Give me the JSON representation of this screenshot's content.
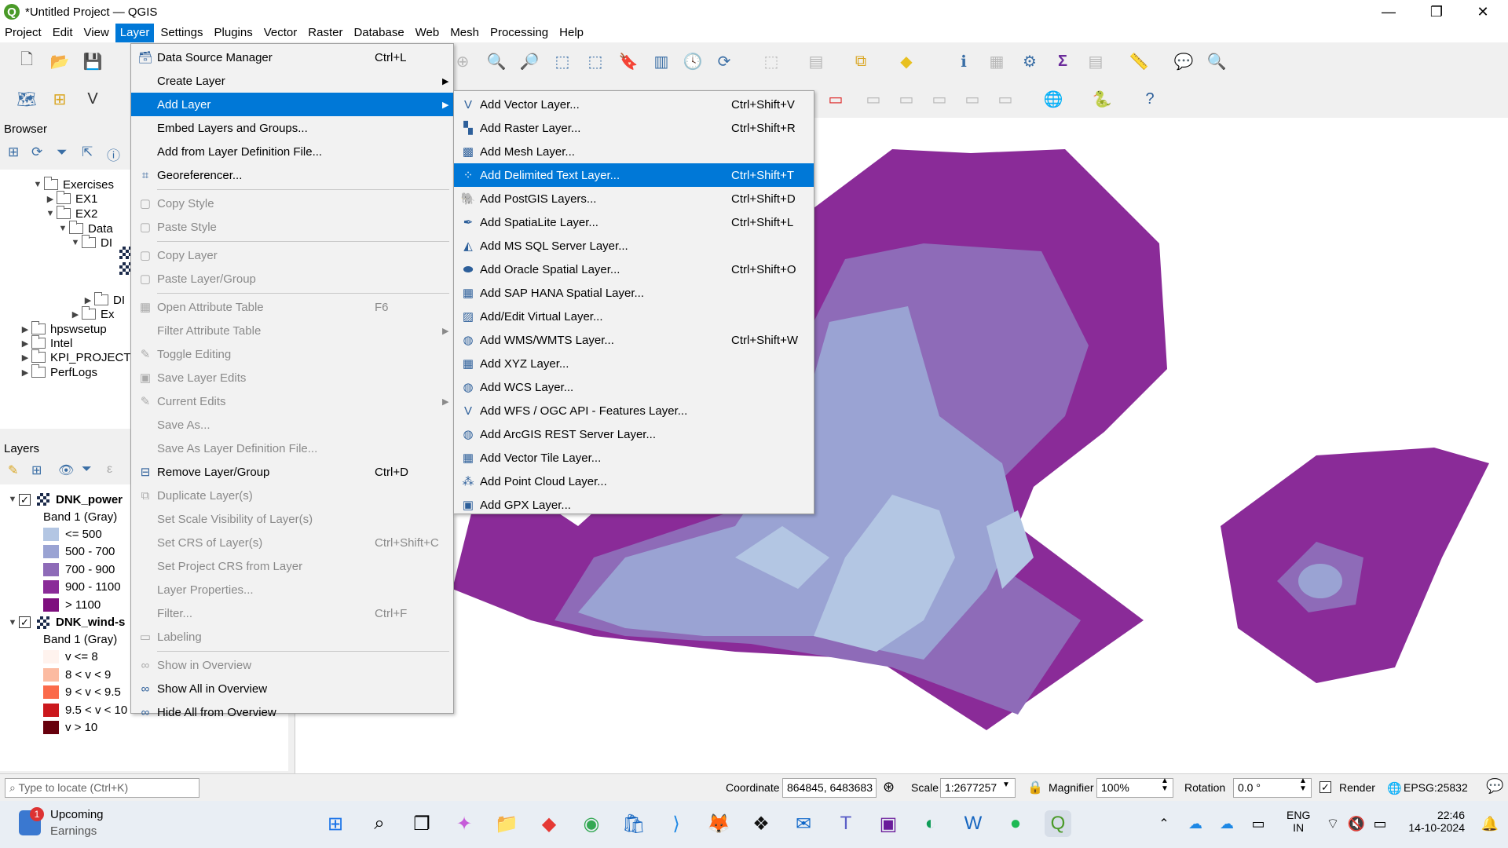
{
  "window": {
    "title": "*Untitled Project — QGIS",
    "app_icon": "qgis-logo",
    "logo_letter": "Q",
    "controls": {
      "minimize": "—",
      "maximize": "❐",
      "close": "✕"
    }
  },
  "menubar": [
    "Project",
    "Edit",
    "View",
    "Layer",
    "Settings",
    "Plugins",
    "Vector",
    "Raster",
    "Database",
    "Web",
    "Mesh",
    "Processing",
    "Help"
  ],
  "active_menu": "Layer",
  "browser_panel": {
    "title": "Browser",
    "items": [
      {
        "label": "Exercises",
        "expanded": true
      },
      {
        "label": "EX1",
        "expanded": false
      },
      {
        "label": "EX2",
        "expanded": true
      },
      {
        "label": "Data",
        "expanded": true
      },
      {
        "label": "DI",
        "expanded": true
      },
      {
        "label": "DI",
        "expanded": false
      },
      {
        "label": "Ex",
        "expanded": false
      },
      {
        "label": "hpswsetup",
        "expanded": false
      },
      {
        "label": "Intel",
        "expanded": false
      },
      {
        "label": "KPI_PROJECTV",
        "expanded": false
      },
      {
        "label": "PerfLogs",
        "expanded": false
      }
    ]
  },
  "layers_panel": {
    "title": "Layers",
    "layers": [
      {
        "name": "DNK_power",
        "checked": true,
        "band": "Band 1 (Gray)",
        "classes": [
          {
            "label": "<= 500",
            "color": "#b3c6e3"
          },
          {
            "label": "500 - 700",
            "color": "#9aa3d3"
          },
          {
            "label": "700 - 900",
            "color": "#8e6bb8"
          },
          {
            "label": "900 - 1100",
            "color": "#8a2b98"
          },
          {
            "label": "> 1100",
            "color": "#7e0f7e"
          }
        ]
      },
      {
        "name": "DNK_wind-s",
        "checked": true,
        "band": "Band 1 (Gray)",
        "classes": [
          {
            "label": "v <= 8",
            "color": "#fff3ee"
          },
          {
            "label": "8 < v < 9",
            "color": "#fcbba1"
          },
          {
            "label": "9 < v < 9.5",
            "color": "#fb6a4a"
          },
          {
            "label": "9.5 < v < 10",
            "color": "#cb181d"
          },
          {
            "label": "v > 10",
            "color": "#67000d"
          }
        ]
      }
    ]
  },
  "layer_menu": [
    {
      "label": "Data Source Manager",
      "shortcut": "Ctrl+L",
      "enabled": true,
      "icon": "data-source-manager-icon"
    },
    {
      "label": "Create Layer",
      "submenu": true,
      "enabled": true
    },
    {
      "label": "Add Layer",
      "submenu": true,
      "enabled": true,
      "highlighted": true
    },
    {
      "label": "Embed Layers and Groups...",
      "enabled": true
    },
    {
      "label": "Add from Layer Definition File...",
      "enabled": true
    },
    {
      "label": "Georeferencer...",
      "enabled": true,
      "icon": "georeferencer-icon"
    },
    {
      "sep": true
    },
    {
      "label": "Copy Style",
      "enabled": false,
      "icon": "copy-style-icon"
    },
    {
      "label": "Paste Style",
      "enabled": false,
      "icon": "paste-style-icon"
    },
    {
      "sep": true
    },
    {
      "label": "Copy Layer",
      "enabled": false,
      "icon": "copy-layer-icon"
    },
    {
      "label": "Paste Layer/Group",
      "enabled": false,
      "icon": "paste-layer-icon"
    },
    {
      "sep": true
    },
    {
      "label": "Open Attribute Table",
      "shortcut": "F6",
      "enabled": false,
      "icon": "attribute-table-icon"
    },
    {
      "label": "Filter Attribute Table",
      "submenu": true,
      "enabled": false
    },
    {
      "label": "Toggle Editing",
      "enabled": false,
      "icon": "pencil-icon"
    },
    {
      "label": "Save Layer Edits",
      "enabled": false,
      "icon": "save-edits-icon"
    },
    {
      "label": "Current Edits",
      "submenu": true,
      "enabled": false,
      "icon": "current-edits-icon"
    },
    {
      "label": "Save As...",
      "enabled": false
    },
    {
      "label": "Save As Layer Definition File...",
      "enabled": false
    },
    {
      "label": "Remove Layer/Group",
      "shortcut": "Ctrl+D",
      "enabled": true,
      "icon": "remove-layer-icon"
    },
    {
      "label": "Duplicate Layer(s)",
      "enabled": false,
      "icon": "duplicate-layer-icon"
    },
    {
      "label": "Set Scale Visibility of Layer(s)",
      "enabled": false
    },
    {
      "label": "Set CRS of Layer(s)",
      "shortcut": "Ctrl+Shift+C",
      "enabled": false
    },
    {
      "label": "Set Project CRS from Layer",
      "enabled": false
    },
    {
      "label": "Layer Properties...",
      "enabled": false
    },
    {
      "label": "Filter...",
      "shortcut": "Ctrl+F",
      "enabled": false
    },
    {
      "label": "Labeling",
      "enabled": false,
      "icon": "labeling-icon"
    },
    {
      "sep": true
    },
    {
      "label": "Show in Overview",
      "enabled": false,
      "icon": "glasses-icon"
    },
    {
      "label": "Show All in Overview",
      "enabled": true,
      "icon": "glasses-icon"
    },
    {
      "label": "Hide All from Overview",
      "enabled": true,
      "icon": "hide-overview-icon"
    }
  ],
  "add_layer_menu": [
    {
      "label": "Add Vector Layer...",
      "shortcut": "Ctrl+Shift+V",
      "icon": "vector-layer-icon"
    },
    {
      "label": "Add Raster Layer...",
      "shortcut": "Ctrl+Shift+R",
      "icon": "raster-layer-icon"
    },
    {
      "label": "Add Mesh Layer...",
      "shortcut": "",
      "icon": "mesh-layer-icon"
    },
    {
      "label": "Add Delimited Text Layer...",
      "shortcut": "Ctrl+Shift+T",
      "icon": "delimited-text-icon",
      "highlighted": true
    },
    {
      "label": "Add PostGIS Layers...",
      "shortcut": "Ctrl+Shift+D",
      "icon": "postgis-icon"
    },
    {
      "label": "Add SpatiaLite Layer...",
      "shortcut": "Ctrl+Shift+L",
      "icon": "spatialite-icon"
    },
    {
      "label": "Add MS SQL Server Layer...",
      "shortcut": "",
      "icon": "mssql-icon"
    },
    {
      "label": "Add Oracle Spatial Layer...",
      "shortcut": "Ctrl+Shift+O",
      "icon": "oracle-icon"
    },
    {
      "label": "Add SAP HANA Spatial Layer...",
      "shortcut": "",
      "icon": "sap-hana-icon"
    },
    {
      "label": "Add/Edit Virtual Layer...",
      "shortcut": "",
      "icon": "virtual-layer-icon"
    },
    {
      "label": "Add WMS/WMTS Layer...",
      "shortcut": "Ctrl+Shift+W",
      "icon": "wms-icon"
    },
    {
      "label": "Add XYZ Layer...",
      "shortcut": "",
      "icon": "xyz-icon"
    },
    {
      "label": "Add WCS Layer...",
      "shortcut": "",
      "icon": "wcs-icon"
    },
    {
      "label": "Add WFS / OGC API - Features Layer...",
      "shortcut": "",
      "icon": "wfs-icon"
    },
    {
      "label": "Add ArcGIS REST Server Layer...",
      "shortcut": "",
      "icon": "arcgis-icon"
    },
    {
      "label": "Add Vector Tile Layer...",
      "shortcut": "",
      "icon": "vector-tile-icon"
    },
    {
      "label": "Add Point Cloud Layer...",
      "shortcut": "",
      "icon": "point-cloud-icon"
    },
    {
      "label": "Add GPX Layer...",
      "shortcut": "",
      "icon": "gpx-icon"
    }
  ],
  "statusbar": {
    "locator_placeholder": "Type to locate (Ctrl+K)",
    "coordinate_label": "Coordinate",
    "coordinate_value": "864845, 6483683",
    "scale_label": "Scale",
    "scale_value": "1:2677257",
    "magnifier_label": "Magnifier",
    "magnifier_value": "100%",
    "rotation_label": "Rotation",
    "rotation_value": "0.0 °",
    "render_label": "Render",
    "render_checked": true,
    "crs": "EPSG:25832"
  },
  "taskbar": {
    "weather_title": "Upcoming",
    "weather_subtitle": "Earnings",
    "notification_count": "1",
    "lang_line1": "ENG",
    "lang_line2": "IN",
    "time": "22:46",
    "date": "14-10-2024"
  },
  "colors": {
    "highlight": "#0078d7",
    "map_dark": "#8a2b98",
    "map_mid": "#8e6bb8",
    "map_light": "#9aa3d3",
    "map_lightest": "#b3c6e3"
  }
}
